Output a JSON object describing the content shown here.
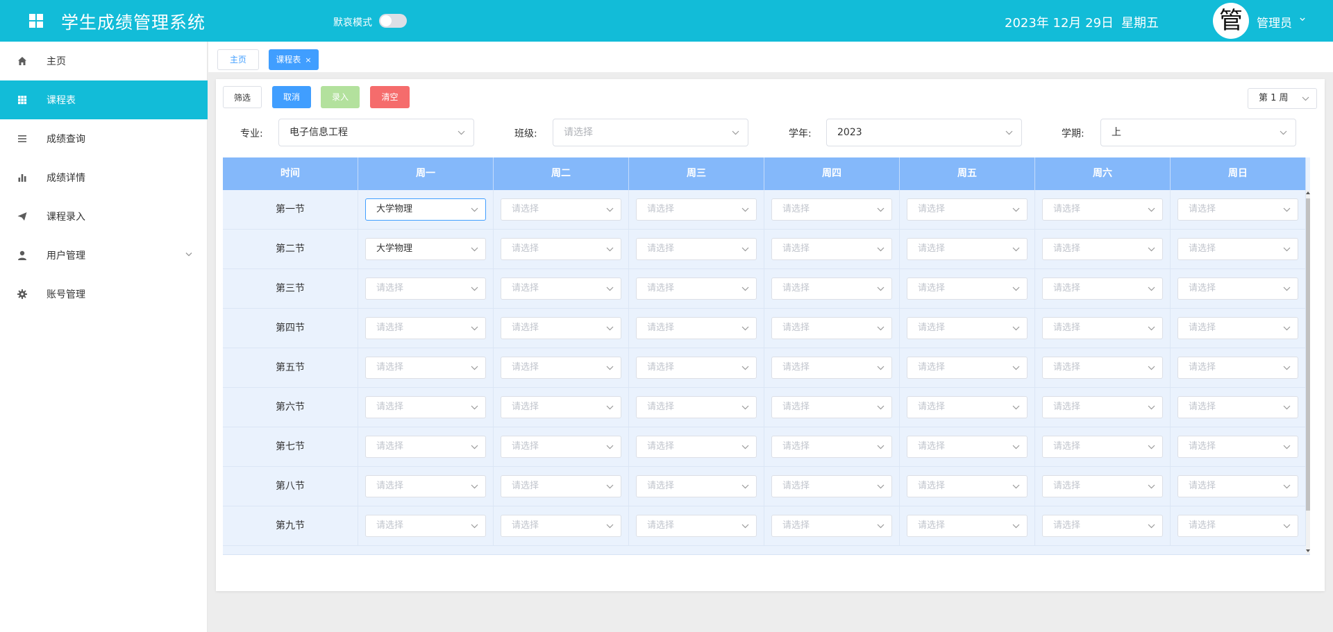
{
  "header": {
    "title": "学生成绩管理系统",
    "dark_mode_label": "默哀模式",
    "date": "2023年 12月 29日",
    "weekday": "星期五",
    "avatar_char": "管",
    "user_name": "管理员",
    "bg_color": "#12bcd8"
  },
  "sidebar": {
    "items": [
      {
        "label": "主页",
        "icon": "home-icon"
      },
      {
        "label": "课程表",
        "icon": "grid-icon"
      },
      {
        "label": "成绩查询",
        "icon": "list-icon"
      },
      {
        "label": "成绩详情",
        "icon": "bar-chart-icon"
      },
      {
        "label": "课程录入",
        "icon": "paper-plane-icon"
      },
      {
        "label": "用户管理",
        "icon": "user-icon"
      },
      {
        "label": "账号管理",
        "icon": "gear-icon"
      }
    ],
    "active_index": 1
  },
  "tabs": [
    {
      "label": "主页"
    },
    {
      "label": "课程表",
      "close": "×"
    }
  ],
  "toolbar": {
    "filter_label": "筛选",
    "cancel_label": "取消",
    "enter_label": "录入",
    "clear_label": "清空",
    "week_value": "第 1 周"
  },
  "filters": {
    "major": {
      "label": "专业:",
      "value": "电子信息工程"
    },
    "class": {
      "label": "班级:",
      "placeholder": "请选择"
    },
    "year": {
      "label": "学年:",
      "value": "2023"
    },
    "term": {
      "label": "学期:",
      "value": "上"
    }
  },
  "table": {
    "headers": [
      "时间",
      "周一",
      "周二",
      "周三",
      "周四",
      "周五",
      "周六",
      "周日"
    ],
    "rows": [
      {
        "label": "第一节",
        "cells": [
          "大学物理",
          "请选择",
          "请选择",
          "请选择",
          "请选择",
          "请选择",
          "请选择"
        ]
      },
      {
        "label": "第二节",
        "cells": [
          "大学物理",
          "请选择",
          "请选择",
          "请选择",
          "请选择",
          "请选择",
          "请选择"
        ]
      },
      {
        "label": "第三节",
        "cells": [
          "请选择",
          "请选择",
          "请选择",
          "请选择",
          "请选择",
          "请选择",
          "请选择"
        ]
      },
      {
        "label": "第四节",
        "cells": [
          "请选择",
          "请选择",
          "请选择",
          "请选择",
          "请选择",
          "请选择",
          "请选择"
        ]
      },
      {
        "label": "第五节",
        "cells": [
          "请选择",
          "请选择",
          "请选择",
          "请选择",
          "请选择",
          "请选择",
          "请选择"
        ]
      },
      {
        "label": "第六节",
        "cells": [
          "请选择",
          "请选择",
          "请选择",
          "请选择",
          "请选择",
          "请选择",
          "请选择"
        ]
      },
      {
        "label": "第七节",
        "cells": [
          "请选择",
          "请选择",
          "请选择",
          "请选择",
          "请选择",
          "请选择",
          "请选择"
        ]
      },
      {
        "label": "第八节",
        "cells": [
          "请选择",
          "请选择",
          "请选择",
          "请选择",
          "请选择",
          "请选择",
          "请选择"
        ]
      },
      {
        "label": "第九节",
        "cells": [
          "请选择",
          "请选择",
          "请选择",
          "请选择",
          "请选择",
          "请选择",
          "请选择"
        ]
      }
    ],
    "header_color": "#84b8fa",
    "body_color": "#eaf2fd"
  }
}
